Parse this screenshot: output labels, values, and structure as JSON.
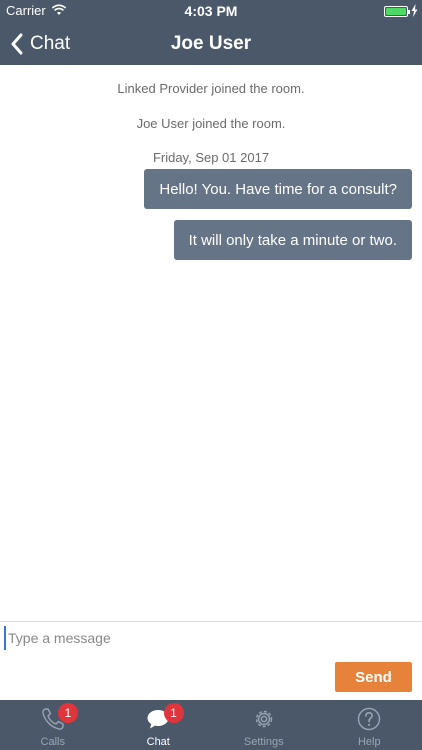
{
  "status_bar": {
    "carrier": "Carrier",
    "time": "4:03 PM"
  },
  "nav": {
    "back_label": "Chat",
    "title": "Joe User"
  },
  "chat": {
    "system_messages": [
      "Linked Provider joined the room.",
      "Joe User joined the room."
    ],
    "date_label": "Friday, Sep 01 2017",
    "messages": [
      {
        "text": "Hello! You. Have time for a consult?"
      },
      {
        "text": "It will only take a minute or two."
      }
    ]
  },
  "compose": {
    "placeholder": "Type a message",
    "send_label": "Send"
  },
  "tabs": [
    {
      "label": "Calls",
      "icon": "phone-icon",
      "badge": "1"
    },
    {
      "label": "Chat",
      "icon": "chat-bubble-icon",
      "badge": "1",
      "active": true
    },
    {
      "label": "Settings",
      "icon": "gear-icon"
    },
    {
      "label": "Help",
      "icon": "question-icon"
    }
  ],
  "colors": {
    "header_bg": "#4a5869",
    "bubble_bg": "#667488",
    "send_button": "#e6823a",
    "badge": "#e0353b",
    "battery": "#4cd964"
  }
}
